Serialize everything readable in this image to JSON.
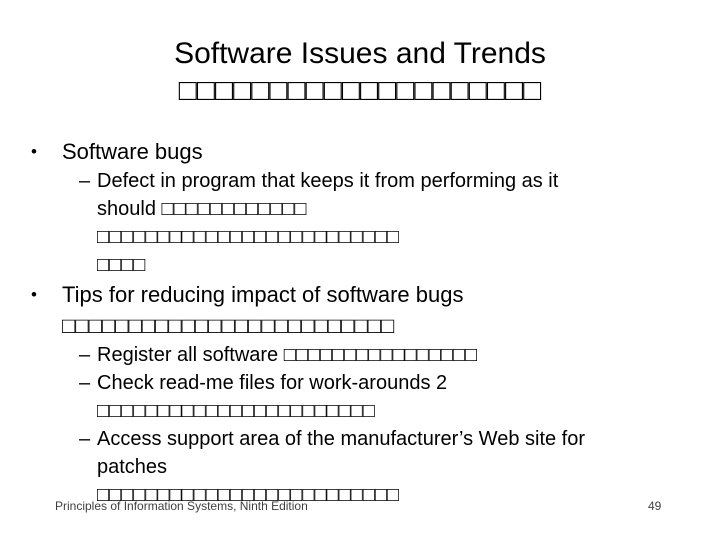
{
  "slide": {
    "background_color": "#ffffff",
    "text_color": "#000000",
    "title": {
      "text": "Software Issues and Trends",
      "missing_glyphs": "□□□□□□□□□□□□□□□□□□□□"
    },
    "bullets": [
      {
        "level": 1,
        "marker": "•",
        "text": "Software bugs"
      },
      {
        "level": 2,
        "marker": "–",
        "line1": "Defect in program that keeps it from performing as it",
        "line2": "should □□□□□□□□□□□□",
        "line3": "□□□□□□□□□□□□□□□□□□□□□□□□□",
        "line4": "□□□□"
      },
      {
        "level": 1,
        "marker": "•",
        "text": "Tips for reducing impact of software bugs",
        "trailing_glyphs": "□□□□□□□□□□□□□□□□□□□□□□□□□"
      },
      {
        "level": 2,
        "marker": "–",
        "line1": "Register all software □□□□□□□□□□□□□□□□"
      },
      {
        "level": 2,
        "marker": "–",
        "line1": "Check read-me files for work-arounds 2",
        "line2": "□□□□□□□□□□□□□□□□□□□□□□□"
      },
      {
        "level": 2,
        "marker": "–",
        "line1": "Access support area of the manufacturer’s Web site for",
        "line2": "patches",
        "line3": "□□□□□□□□□□□□□□□□□□□□□□□□□"
      }
    ],
    "footer": {
      "source": "Principles of Information Systems, Ninth Edition",
      "page_number": "49"
    }
  }
}
